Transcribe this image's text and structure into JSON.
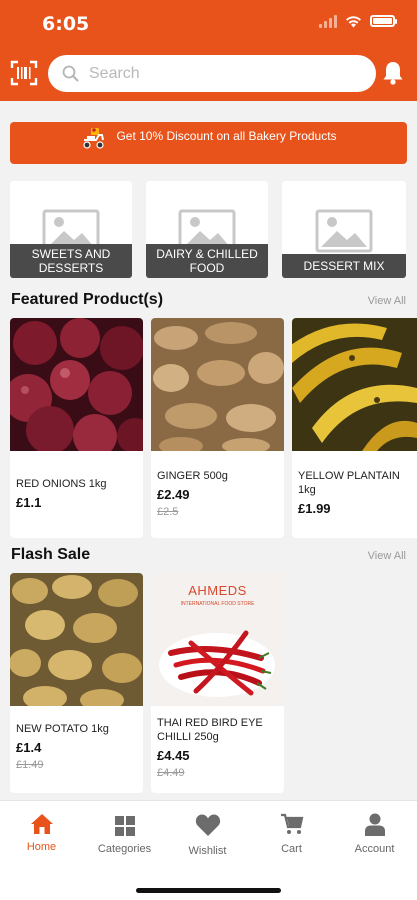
{
  "status_bar": {
    "time": "6:05"
  },
  "search": {
    "placeholder": "Search"
  },
  "icons": {
    "scan": "barcode-scan-icon",
    "search": "search-icon",
    "bell": "bell-icon",
    "promo": "delivery-scooter-icon",
    "placeholder": "image-placeholder-icon"
  },
  "colors": {
    "brand": "#e8531c",
    "label_bg": "#4a4a4a"
  },
  "promo": {
    "text": "Get 10% Discount on all Bakery Products"
  },
  "categories": [
    {
      "label": "SWEETS AND DESSERTS"
    },
    {
      "label": "DAIRY & CHILLED FOOD"
    },
    {
      "label": "DESSERT MIX"
    }
  ],
  "featured": {
    "title": "Featured Product(s)",
    "view_all": "View All",
    "products": [
      {
        "name": "RED ONIONS 1kg",
        "price": "£1.1",
        "old_price": ""
      },
      {
        "name": "GINGER 500g",
        "price": "£2.49",
        "old_price": "£2.5"
      },
      {
        "name": "YELLOW PLANTAIN 1kg",
        "price": "£1.99",
        "old_price": ""
      }
    ]
  },
  "flash_sale": {
    "title": "Flash Sale",
    "view_all": "View All",
    "products": [
      {
        "name": "NEW POTATO 1kg",
        "price": "£1.4",
        "old_price": "£1.49"
      },
      {
        "name": "THAI RED BIRD EYE CHILLI 250g",
        "price": "£4.45",
        "old_price": "£4.49",
        "image_brand": "AHMEDS",
        "image_tagline": "INTERNATIONAL FOOD STORE"
      }
    ]
  },
  "tabbar": {
    "items": [
      {
        "label": "Home",
        "icon": "home-icon",
        "active": true
      },
      {
        "label": "Categories",
        "icon": "categories-grid-icon",
        "active": false
      },
      {
        "label": "Wishlist",
        "icon": "heart-icon",
        "active": false
      },
      {
        "label": "Cart",
        "icon": "cart-icon",
        "active": false
      },
      {
        "label": "Account",
        "icon": "account-icon",
        "active": false
      }
    ]
  }
}
